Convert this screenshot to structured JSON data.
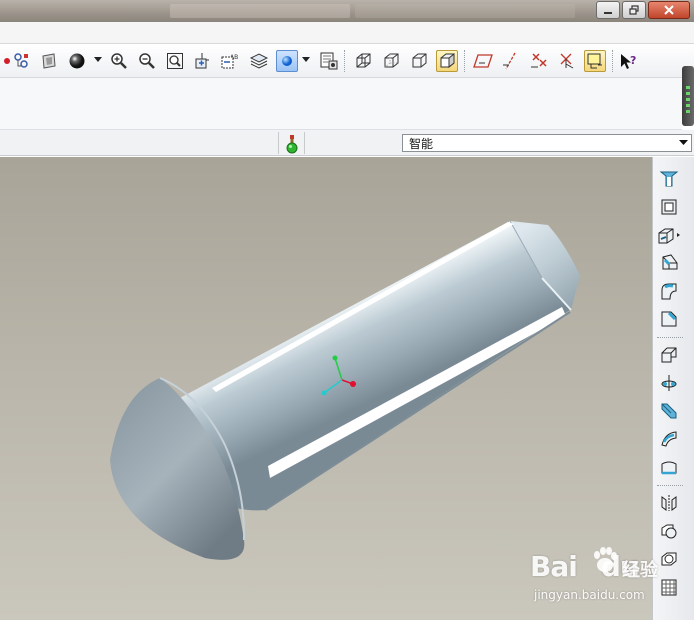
{
  "window": {
    "controls": [
      "minimize",
      "restore",
      "close"
    ]
  },
  "toolbar": {
    "icons": [
      "regenerate-icon",
      "model-tree-icon",
      "appearance-icon",
      "shading-sphere-icon",
      "zoom-in-icon",
      "zoom-out-icon",
      "refit-icon",
      "reorient-icon",
      "saved-views-icon",
      "layers-icon",
      "spin-center-icon",
      "view-manager-icon",
      "wireframe-icon",
      "hidden-line-icon",
      "no-hidden-icon",
      "shading-icon",
      "datum-planes-icon",
      "datum-axes-icon",
      "datum-points-icon",
      "coordinate-systems-icon",
      "annotations-icon",
      "context-help-icon"
    ]
  },
  "filter": {
    "selected": "智能"
  },
  "right_toolbar": {
    "icons": [
      "hole-icon",
      "shell-icon",
      "rib-icon",
      "draft-icon",
      "round-icon",
      "chamfer-icon",
      "extrude-icon",
      "revolve-icon",
      "variable-sweep-icon",
      "blend-icon",
      "boundary-icon",
      "mirror-icon",
      "merge-icon",
      "trim-icon",
      "pattern-icon"
    ]
  },
  "watermark": {
    "brand_a": "Bai",
    "brand_b": "du",
    "site_cn": "经验",
    "url": "jingyan.baidu.com"
  },
  "colors": {
    "viewport_top": "#a8a498",
    "viewport_bottom": "#cac7bd",
    "part_surface": "#b6c6cf",
    "part_shadow": "#7e8e98",
    "axis_x": "#e01030",
    "axis_y": "#22cc44",
    "axis_z": "#22cccc"
  }
}
